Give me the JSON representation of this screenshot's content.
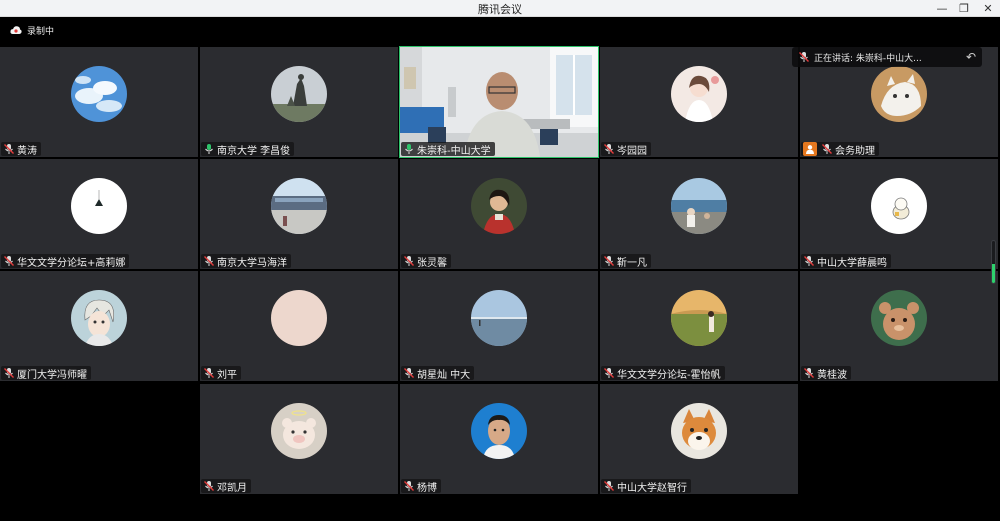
{
  "window": {
    "title": "腾讯会议",
    "minimize": "—",
    "maximize": "❐",
    "close": "✕"
  },
  "recording": {
    "label": "录制中",
    "icon": "cloud-record-icon"
  },
  "speaking": {
    "label": "正在讲话: 朱崇科-中山大...",
    "icon": "mic-icon",
    "back_icon": "back-arrow-icon"
  },
  "scroll": {
    "level": 0.45,
    "color": "#2ed26d"
  },
  "participants": [
    {
      "name": "黄涛",
      "mic": "muted",
      "avatar": "sky-clouds"
    },
    {
      "name": "南京大学 李昌俊",
      "mic": "on",
      "avatar": "statue"
    },
    {
      "name": "朱崇科-中山大学",
      "mic": "on",
      "avatar": "video"
    },
    {
      "name": "岑园园",
      "mic": "muted",
      "avatar": "girl-illustration"
    },
    {
      "name": "会务助理",
      "mic": "muted",
      "avatar": "cat",
      "badge": "person-badge-icon"
    },
    {
      "name": "华文文学分论坛+高莉娜",
      "mic": "muted",
      "avatar": "white-bell"
    },
    {
      "name": "南京大学马海洋",
      "mic": "muted",
      "avatar": "building"
    },
    {
      "name": "张灵馨",
      "mic": "muted",
      "avatar": "woman-photo"
    },
    {
      "name": "靳一凡",
      "mic": "muted",
      "avatar": "coast"
    },
    {
      "name": "中山大学薛晨鸣",
      "mic": "muted",
      "avatar": "cartoon-white"
    },
    {
      "name": "厦门大学冯师曜",
      "mic": "muted",
      "avatar": "anime-boy"
    },
    {
      "name": "刘平",
      "mic": "muted",
      "avatar": "pink-blank"
    },
    {
      "name": "胡星灿 中大",
      "mic": "muted",
      "avatar": "sea-horizon"
    },
    {
      "name": "华文文学分论坛-霍怡帆",
      "mic": "muted",
      "avatar": "meadow"
    },
    {
      "name": "黄桂波",
      "mic": "muted",
      "avatar": "bear"
    },
    {
      "name": "邓凯月",
      "mic": "muted",
      "avatar": "cartoon-pig"
    },
    {
      "name": "杨博",
      "mic": "muted",
      "avatar": "man-photo"
    },
    {
      "name": "中山大学赵智行",
      "mic": "muted",
      "avatar": "shiba-dog"
    }
  ]
}
